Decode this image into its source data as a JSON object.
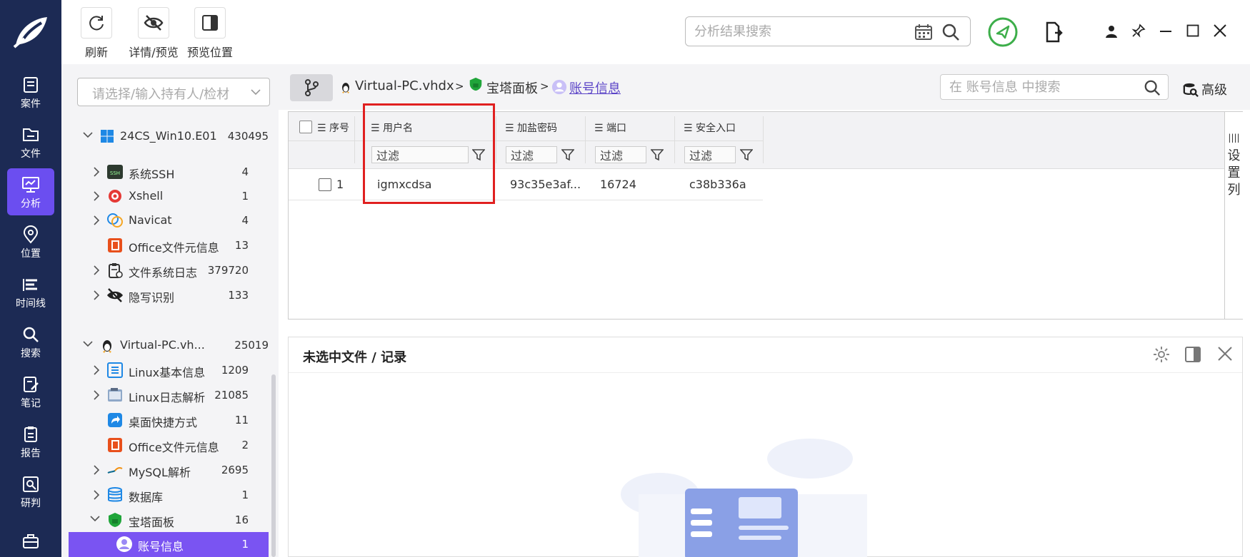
{
  "toolbar": {
    "refresh_label": "刷新",
    "detail_preview_label": "详情/预览",
    "preview_position_label": "预览位置"
  },
  "global_search": {
    "placeholder": "分析结果搜索"
  },
  "rail": {
    "items": [
      {
        "label": "案件",
        "icon": "case-icon"
      },
      {
        "label": "文件",
        "icon": "folder-icon"
      },
      {
        "label": "分析",
        "icon": "monitor-icon",
        "active": true
      },
      {
        "label": "位置",
        "icon": "location-icon"
      },
      {
        "label": "时间线",
        "icon": "timeline-icon"
      },
      {
        "label": "搜索",
        "icon": "search-icon"
      },
      {
        "label": "笔记",
        "icon": "note-icon"
      },
      {
        "label": "报告",
        "icon": "report-icon"
      },
      {
        "label": "研判",
        "icon": "judge-icon"
      }
    ]
  },
  "owner_select": {
    "placeholder": "请选择/输入持有人/检材"
  },
  "tree": {
    "items": [
      {
        "label": "24CS_Win10.E01",
        "count": "430495"
      },
      {
        "label": "系统SSH",
        "count": "4"
      },
      {
        "label": "Xshell",
        "count": "1"
      },
      {
        "label": "Navicat",
        "count": "4"
      },
      {
        "label": "Office文件元信息",
        "count": "13"
      },
      {
        "label": "文件系统日志",
        "count": "379720"
      },
      {
        "label": "隐写识别",
        "count": "133"
      },
      {
        "label": "Virtual-PC.vh...",
        "count": "25019"
      },
      {
        "label": "Linux基本信息",
        "count": "1209"
      },
      {
        "label": "Linux日志解析",
        "count": "21085"
      },
      {
        "label": "桌面快捷方式",
        "count": "11"
      },
      {
        "label": "Office文件元信息",
        "count": "2"
      },
      {
        "label": "MySQL解析",
        "count": "2695"
      },
      {
        "label": "数据库",
        "count": "1"
      },
      {
        "label": "宝塔面板",
        "count": "16"
      },
      {
        "label": "账号信息",
        "count": "1"
      }
    ]
  },
  "breadcrumb": {
    "items": [
      "Virtual-PC.vhdx",
      "宝塔面板",
      "账号信息"
    ],
    "separator": ">"
  },
  "content_search": {
    "placeholder": "在 账号信息 中搜索"
  },
  "advanced_label": "高级",
  "grid": {
    "columns": [
      "序号",
      "用户名",
      "加盐密码",
      "端口",
      "安全入口"
    ],
    "filter_label": "过滤",
    "rows": [
      {
        "index": "1",
        "username": "igmxcdsa",
        "salted_password": "93c35e3af...",
        "port": "16724",
        "entry": "c38b336a"
      }
    ],
    "set_columns_label": "设置列"
  },
  "detail": {
    "title": "未选中文件 / 记录"
  },
  "colors": {
    "rail_bg": "#1c2a54",
    "accent": "#6b4ef0",
    "highlight": "#e02020",
    "status_green": "#3dae4a"
  }
}
